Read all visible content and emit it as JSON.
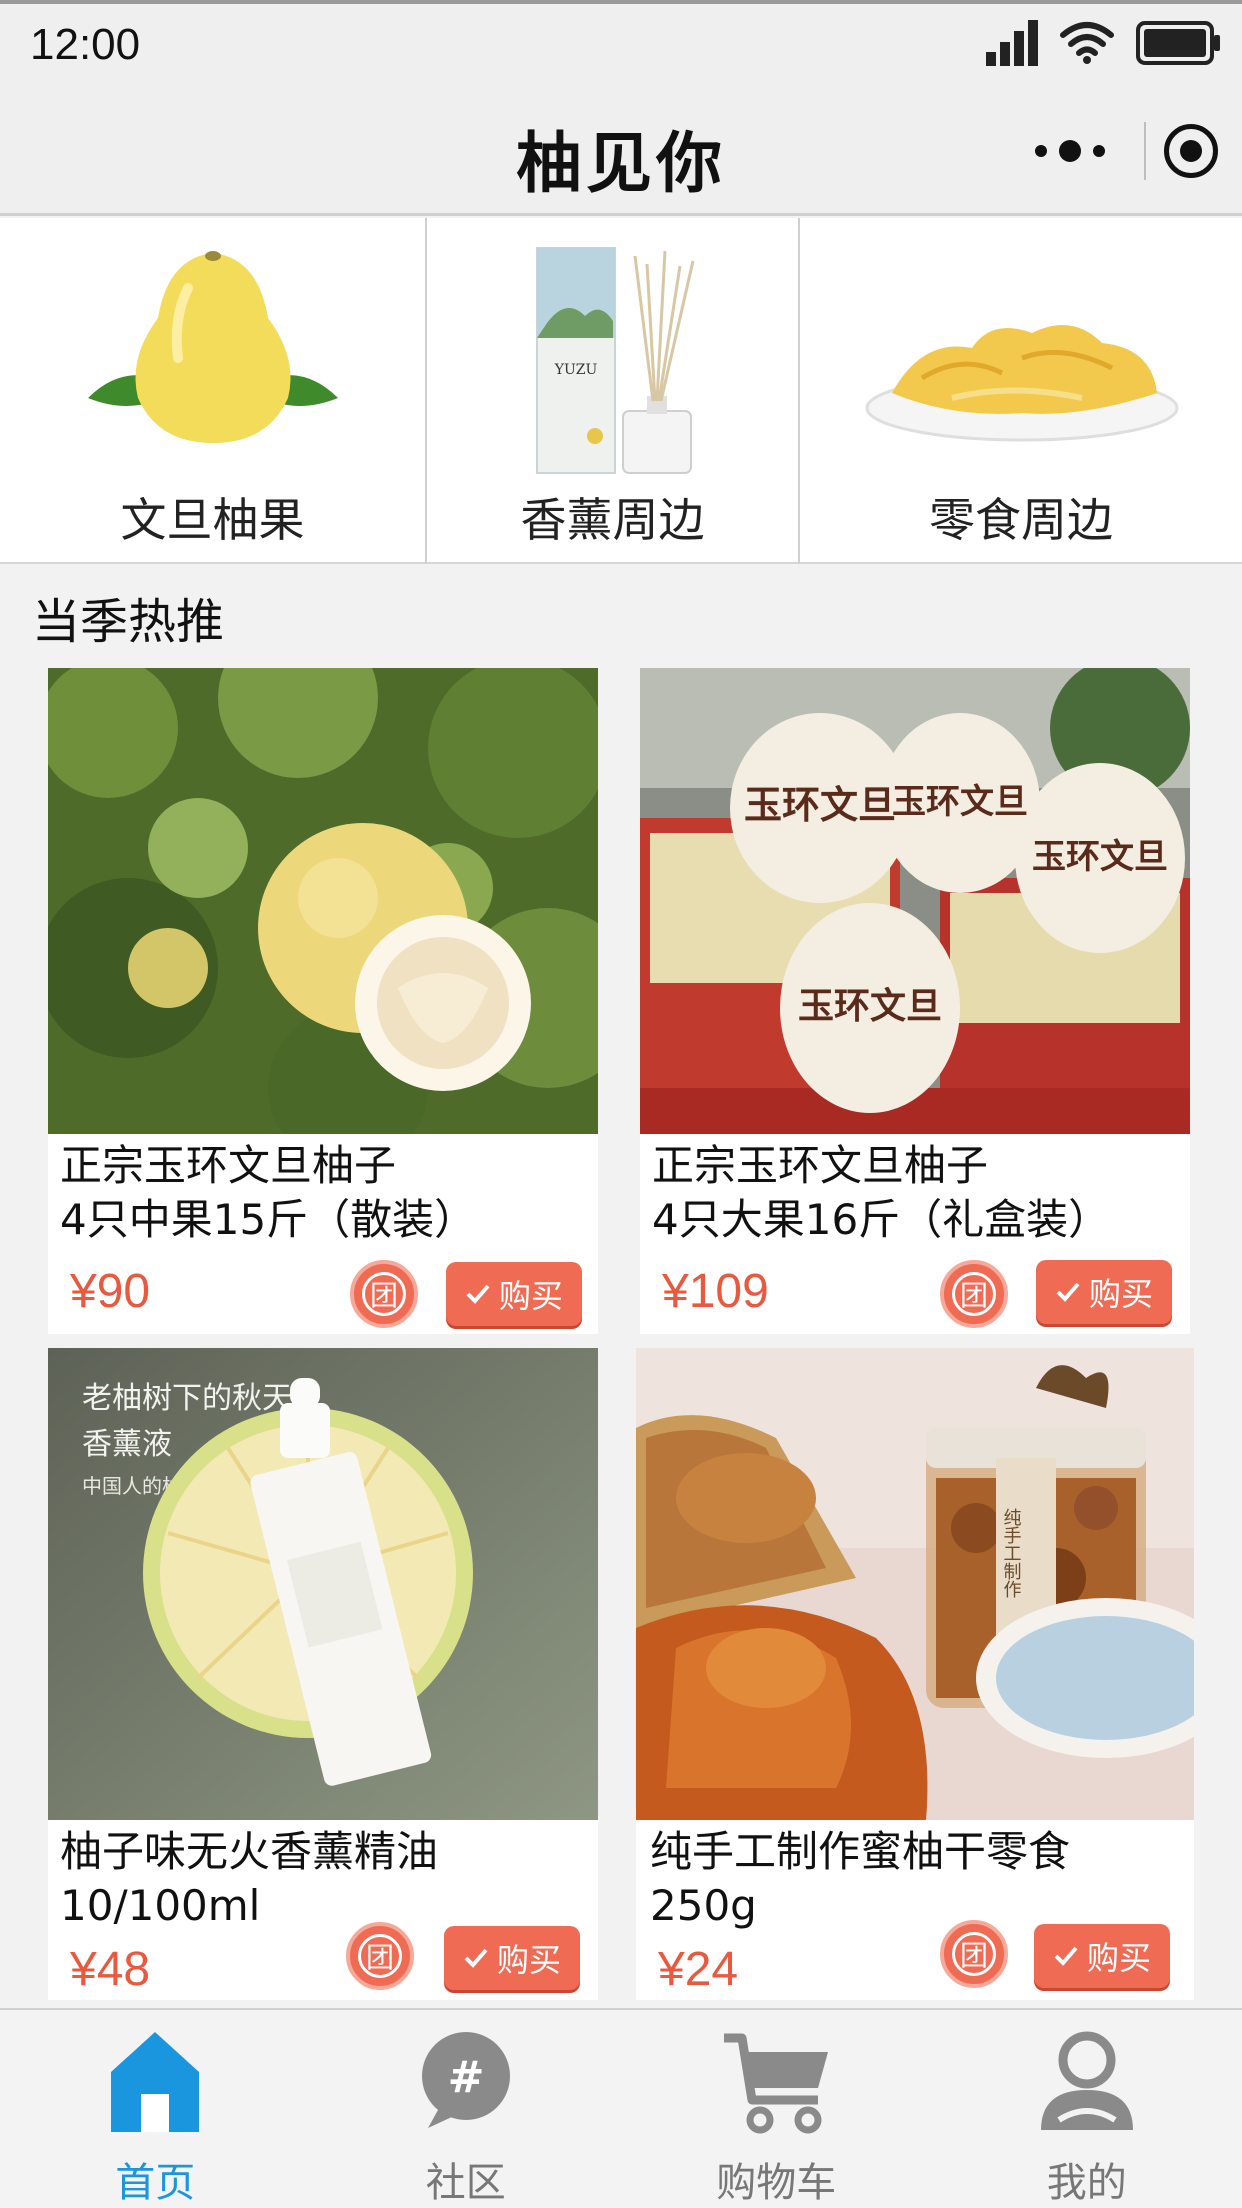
{
  "status_bar": {
    "time": "12:00"
  },
  "nav": {
    "title": "柚见你"
  },
  "categories": [
    {
      "label": "文旦柚果",
      "icon": "pomelo-image"
    },
    {
      "label": "香薰周边",
      "icon": "aroma-diffuser-image"
    },
    {
      "label": "零食周边",
      "icon": "pomelo-snack-image"
    }
  ],
  "section": {
    "title": "当季热推"
  },
  "products": [
    {
      "name_line1": "正宗玉环文旦柚子",
      "name_line2": "4只中果15斤（散装）",
      "price": "¥90",
      "group_label": "团",
      "buy_label": "购买"
    },
    {
      "name_line1": "正宗玉环文旦柚子",
      "name_line2": "4只大果16斤（礼盒装）",
      "price": "¥109",
      "group_label": "团",
      "buy_label": "购买",
      "image_text": "玉环文旦"
    },
    {
      "name_line1": "柚子味无火香薰精油",
      "name_line2": "10/100ml",
      "price": "¥48",
      "group_label": "团",
      "buy_label": "购买",
      "image_text_1": "老柚树下的秋天",
      "image_text_2": "香薰液",
      "image_text_3": "中国人的柚子香"
    },
    {
      "name_line1": "纯手工制作蜜柚干零食",
      "name_line2": "250g",
      "price": "¥24",
      "group_label": "团",
      "buy_label": "购买",
      "image_text": "纯手工制作"
    }
  ],
  "tabs": [
    {
      "label": "首页",
      "icon": "home-icon",
      "active": true
    },
    {
      "label": "社区",
      "icon": "community-icon",
      "active": false
    },
    {
      "label": "购物车",
      "icon": "cart-icon",
      "active": false
    },
    {
      "label": "我的",
      "icon": "profile-icon",
      "active": false
    }
  ],
  "colors": {
    "accent": "#ef6b53",
    "price": "#e8593f",
    "tab_active": "#1a96de",
    "tab_inactive": "#8a8a8a"
  }
}
